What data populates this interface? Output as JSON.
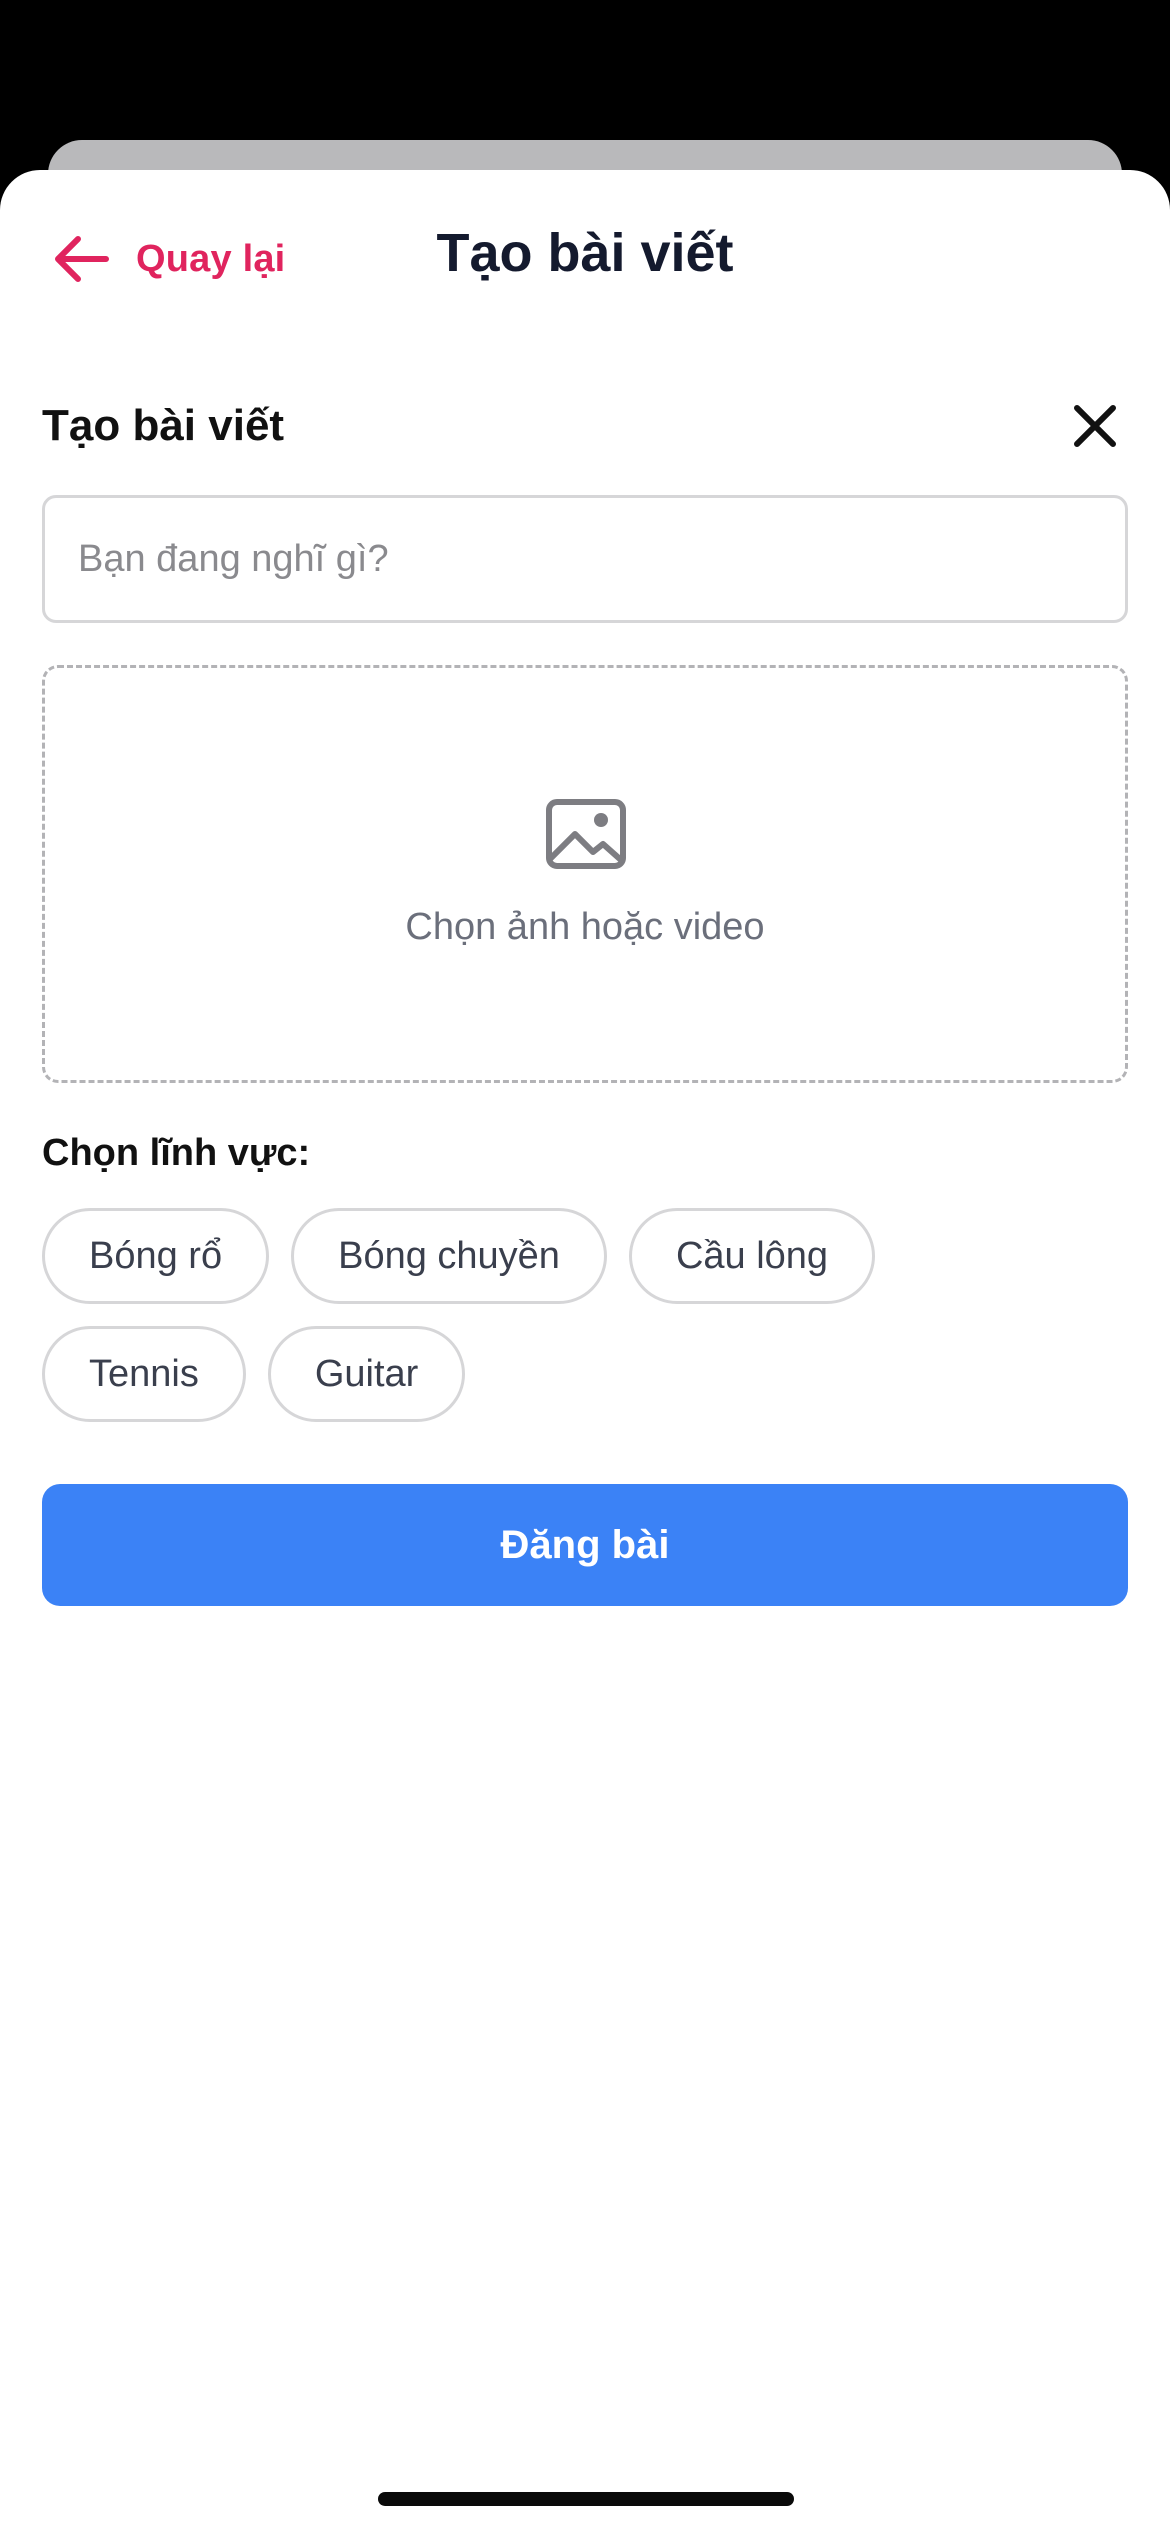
{
  "nav": {
    "back_label": "Quay lại",
    "title": "Tạo bài viết"
  },
  "composer": {
    "heading": "Tạo bài viết",
    "input_value": "",
    "input_placeholder": "Bạn đang nghĩ gì?",
    "media_label": "Chọn ảnh hoặc video",
    "field_label": "Chọn lĩnh vực:",
    "categories": [
      "Bóng rổ",
      "Bóng chuyền",
      "Cầu lông",
      "Tennis",
      "Guitar"
    ],
    "submit_label": "Đăng bài"
  },
  "icons": {
    "back": "arrow-left-icon",
    "close": "close-icon",
    "media": "image-icon"
  },
  "colors": {
    "accent": "#e0245e",
    "primary_button": "#3b82f6",
    "title_text": "#141a2e",
    "muted_text": "#6b6f7b",
    "border": "#d6d6d8"
  }
}
